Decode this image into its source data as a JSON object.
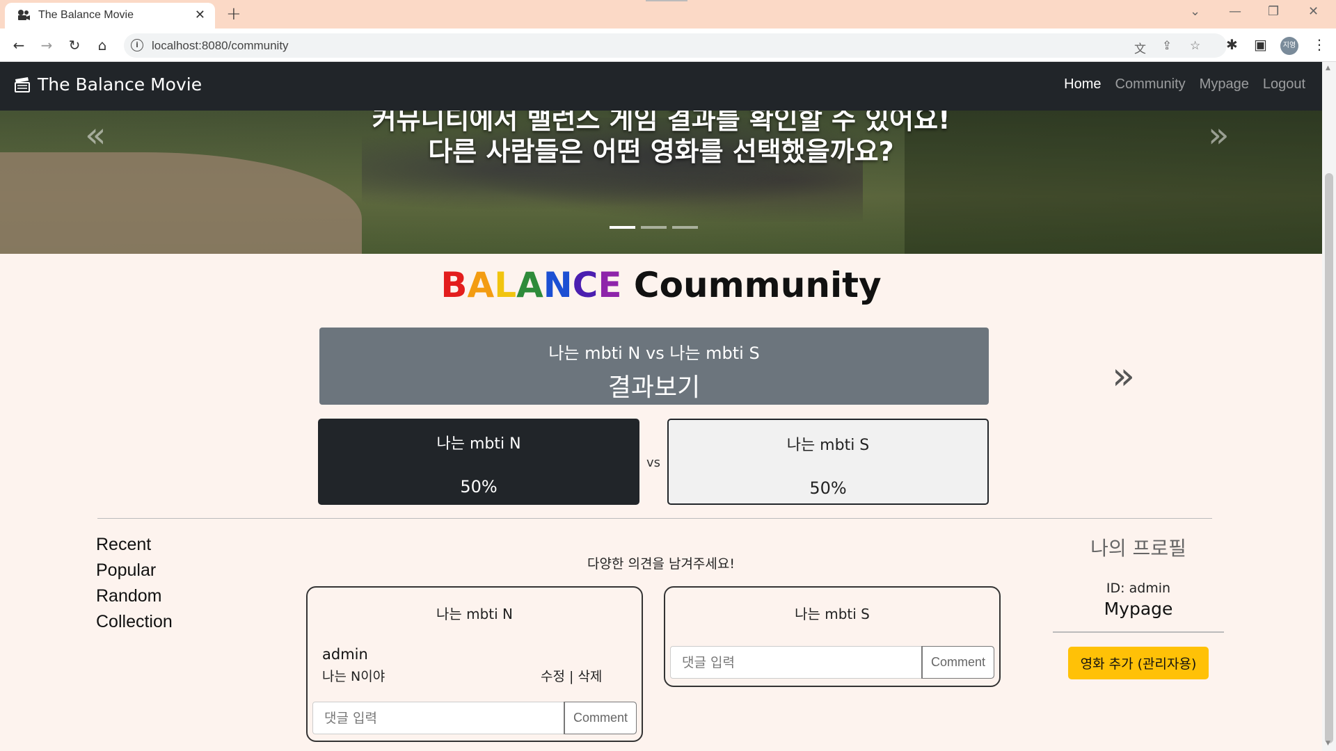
{
  "browser": {
    "tab_title": "The Balance Movie",
    "tab_close": "✕",
    "new_tab": "+",
    "url": "localhost:8080/community",
    "profile_initials": "지영",
    "window_controls": {
      "dropdown": "⌄",
      "minimize": "—",
      "restore": "❐",
      "close": "✕"
    }
  },
  "navbar": {
    "brand": "The Balance Movie",
    "links": [
      "Home",
      "Community",
      "Mypage",
      "Logout"
    ],
    "active_link": "Home"
  },
  "carousel": {
    "line1": "커뮤니티에서 밸런스 게임 결과를 확인할 수 있어요!",
    "line2": "다른 사람들은 어떤 영화를 선택했을까요?",
    "prev": "«",
    "next": "»",
    "slide_count": 3,
    "active_slide": 1
  },
  "heading": {
    "letters": [
      {
        "char": "B",
        "color": "#e31d1d"
      },
      {
        "char": "A",
        "color": "#f39c12"
      },
      {
        "char": "L",
        "color": "#f1c40f"
      },
      {
        "char": "A",
        "color": "#2e8b3a"
      },
      {
        "char": "N",
        "color": "#1c4fd3"
      },
      {
        "char": "C",
        "color": "#4b1fb0"
      },
      {
        "char": "E",
        "color": "#8e24aa"
      }
    ],
    "rest": " Coummunity"
  },
  "question": {
    "text": "나는 mbti N vs 나는 mbti S",
    "result_button": "결과보기",
    "next_arrow": "»"
  },
  "options": {
    "a": {
      "name": "나는 mbti N",
      "percent": "50%"
    },
    "vs": "vs",
    "b": {
      "name": "나는 mbti S",
      "percent": "50%"
    }
  },
  "sidebar": {
    "items": [
      "Recent",
      "Popular",
      "Random",
      "Collection"
    ]
  },
  "comments": {
    "prompt": "다양한 의견을 남겨주세요!",
    "side_a": {
      "title": "나는 mbti N",
      "entries": [
        {
          "user": "admin",
          "text": "나는 N이야",
          "actions": "수정 | 삭제"
        }
      ]
    },
    "side_b": {
      "title": "나는 mbti S"
    },
    "input_placeholder": "댓글 입력",
    "submit_label": "Comment"
  },
  "profile": {
    "title": "나의 프로필",
    "id_text": "ID: admin",
    "mypage_link": "Mypage",
    "admin_button": "영화 추가 (관리자용)"
  }
}
